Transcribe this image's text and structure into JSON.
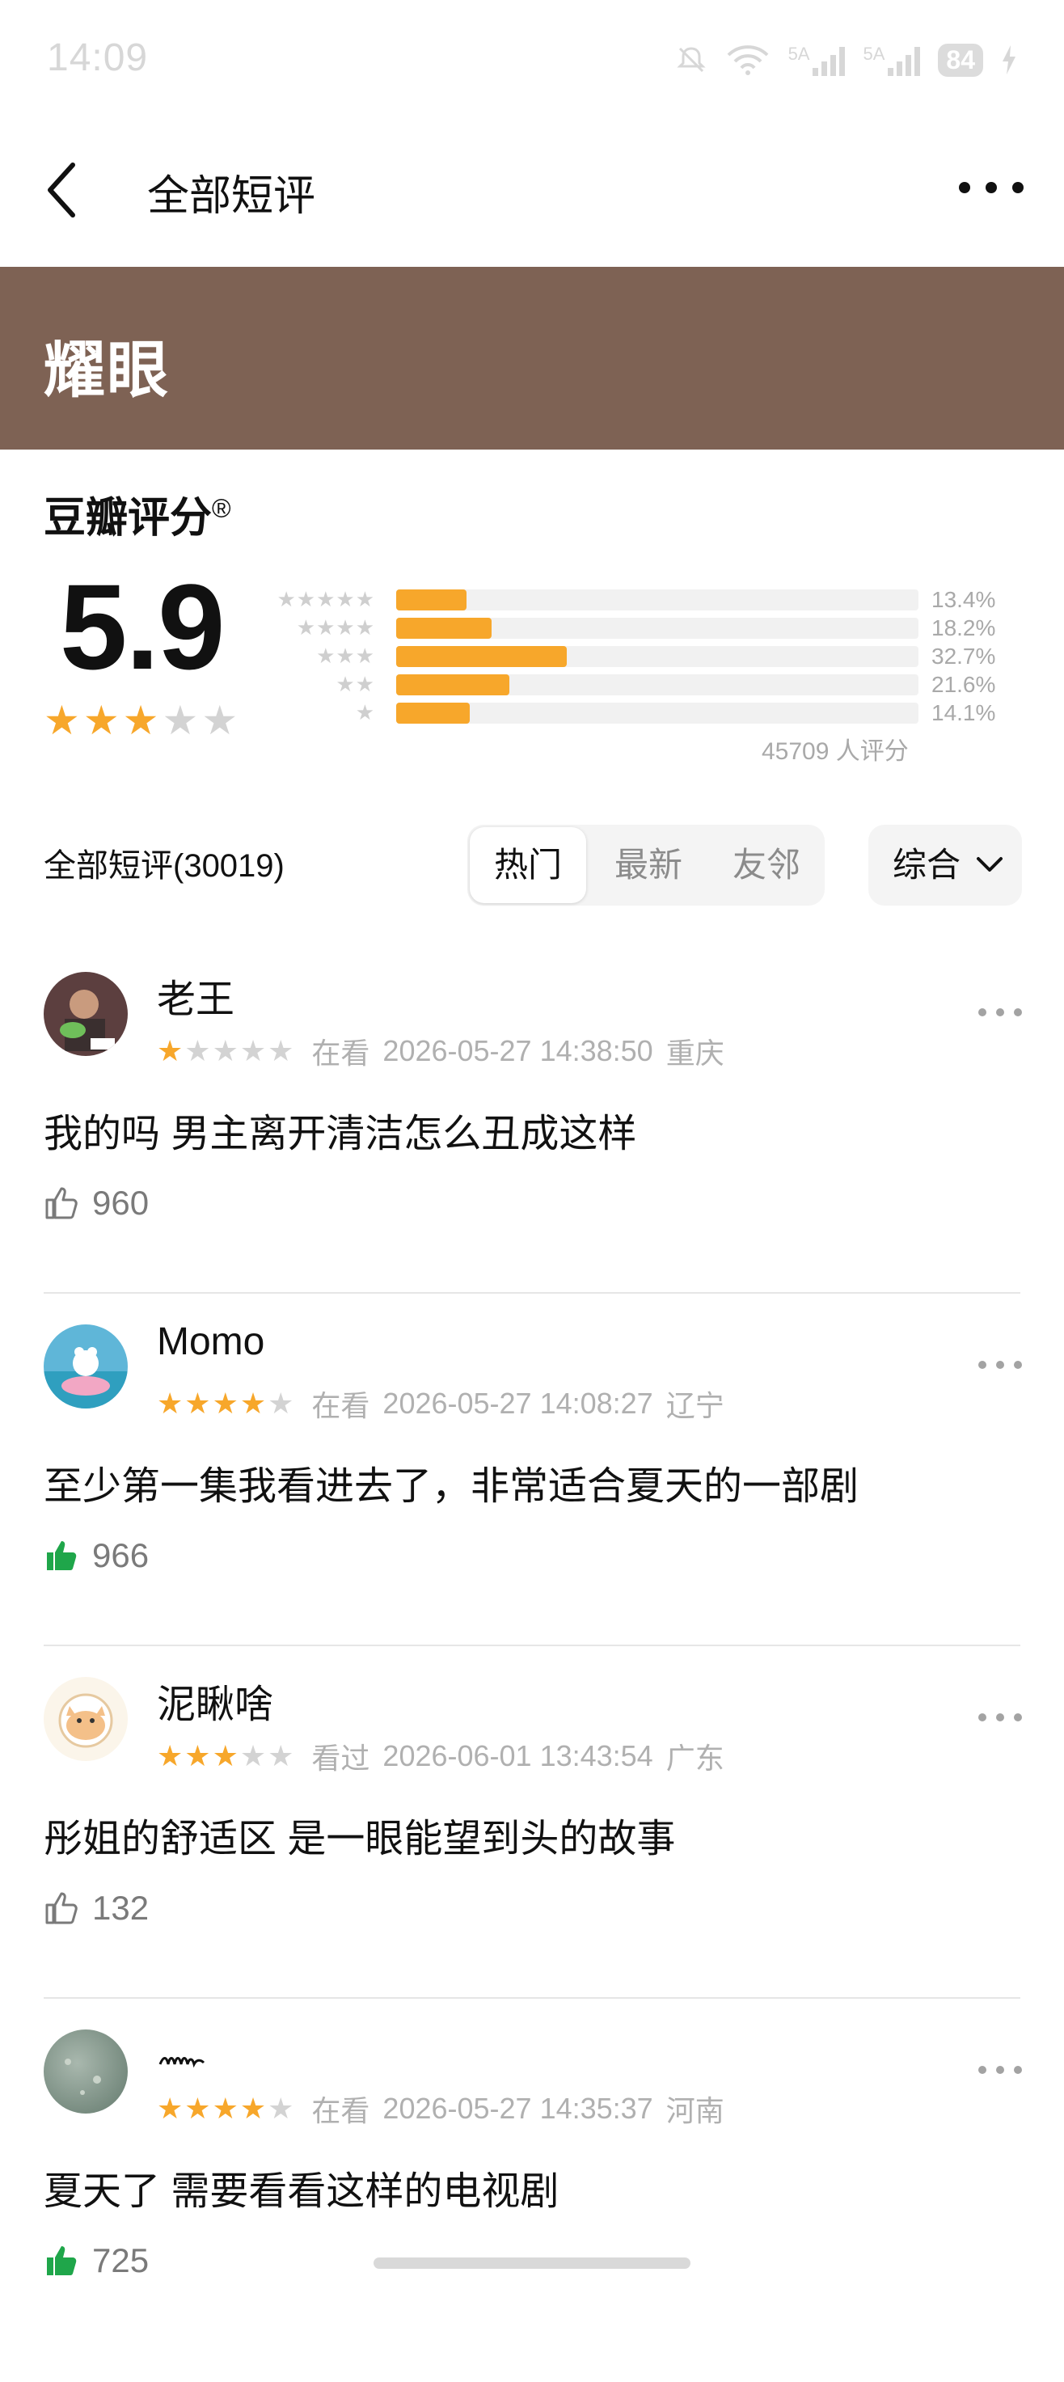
{
  "status_bar": {
    "time": "14:09",
    "signal_1": "5A",
    "signal_2": "5A",
    "battery": "84"
  },
  "nav": {
    "title": "全部短评"
  },
  "banner": {
    "title": "耀眼"
  },
  "rating": {
    "label": "豆瓣评分",
    "mark": "®",
    "score": "5.9",
    "stars": 3,
    "distribution": [
      {
        "stars": "★★★★★",
        "percent_text": "13.4%",
        "percent": 13.4
      },
      {
        "stars": "★★★★",
        "percent_text": "18.2%",
        "percent": 18.2
      },
      {
        "stars": "★★★",
        "percent_text": "32.7%",
        "percent": 32.7
      },
      {
        "stars": "★★",
        "percent_text": "21.6%",
        "percent": 21.6
      },
      {
        "stars": "★",
        "percent_text": "14.1%",
        "percent": 14.1
      }
    ],
    "count_text": "45709 人评分"
  },
  "filter": {
    "all_label": "全部短评(30019)",
    "tabs": [
      {
        "label": "热门",
        "active": true
      },
      {
        "label": "最新",
        "active": false
      },
      {
        "label": "友邻",
        "active": false
      }
    ],
    "sort_label": "综合"
  },
  "reviews": [
    {
      "name": "老王",
      "rating": 1,
      "status": "在看",
      "date": "2026-05-27 14:38:50",
      "location": "重庆",
      "text": "我的吗 男主离开清洁怎么丑成这样",
      "votes": "960",
      "liked": false
    },
    {
      "name": "Momo",
      "rating": 4,
      "status": "在看",
      "date": "2026-05-27 14:08:27",
      "location": "辽宁",
      "text": "至少第一集我看进去了，非常适合夏天的一部剧",
      "votes": "966",
      "liked": true
    },
    {
      "name": "泥瞅啥",
      "rating": 3,
      "status": "看过",
      "date": "2026-06-01 13:43:54",
      "location": "广东",
      "text": "彤姐的舒适区 是一眼能望到头的故事",
      "votes": "132",
      "liked": false
    },
    {
      "name": "",
      "rating": 4,
      "status": "在看",
      "date": "2026-05-27 14:35:37",
      "location": "河南",
      "text": "夏天了 需要看看这样的电视剧",
      "votes": "725",
      "liked": true
    }
  ],
  "colors": {
    "banner": "#7e6254",
    "star": "#f7a72b",
    "liked": "#1fa64a"
  }
}
